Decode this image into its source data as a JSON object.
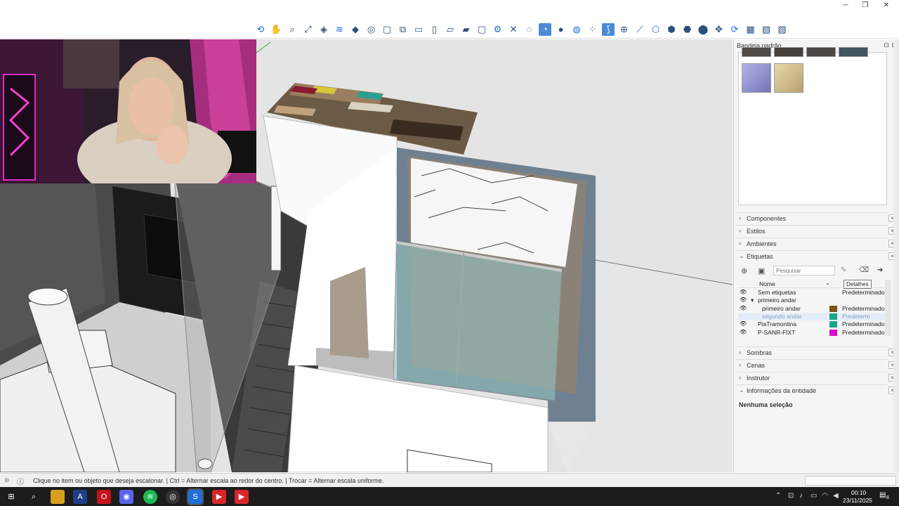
{
  "window": {
    "minimize": "─",
    "restore": "❐",
    "close": "✕"
  },
  "toolbar": {
    "icons": [
      "orbit-icon",
      "pan-icon",
      "zoom-icon",
      "zoom-extents-icon",
      "section-plane-icon",
      "section-cuts-icon",
      "section-fill-icon",
      "view-icon",
      "iso-icon",
      "top-icon",
      "front-icon",
      "right-icon",
      "back-icon",
      "left-icon",
      "xray-icon",
      "back-edges-icon",
      "wireframe-icon",
      "hidden-line-icon",
      "shaded-icon",
      "shaded-textures-icon",
      "monochrome-icon",
      "snap-icon",
      "magnet-icon",
      "axes-icon",
      "guide-icon",
      "cube-icon",
      "cube-outline-icon",
      "cube-solid-icon",
      "cube-x-icon",
      "move-icon",
      "rotate-icon",
      "grid-icon",
      "grid2-icon",
      "grid3-icon"
    ]
  },
  "tray": {
    "title": "Bandeja padrão",
    "panels_top": [
      {
        "label": "Componentes",
        "chev": "›"
      },
      {
        "label": "Estilos",
        "chev": "›"
      },
      {
        "label": "Ambientes",
        "chev": "›"
      },
      {
        "label": "Etiquetas",
        "chev": "⌄"
      }
    ],
    "tags": {
      "search_placeholder": "Pesquisar",
      "tooltip": "Detalhes",
      "col_name": "Nome",
      "rows": [
        {
          "name": "Sem etiquetas",
          "dash": "Predeterminado",
          "color": "",
          "indent": 0,
          "visible": true,
          "dim": false,
          "arrow": ""
        },
        {
          "name": "primeiro andar",
          "dash": "",
          "color": "",
          "indent": 0,
          "visible": true,
          "dim": false,
          "arrow": "▾"
        },
        {
          "name": "primeiro andar",
          "dash": "Predeterminado",
          "color": "#7a5518",
          "indent": 1,
          "visible": true,
          "dim": false,
          "arrow": ""
        },
        {
          "name": "segundo andar",
          "dash": "Predeterm",
          "color": "#1aa58a",
          "indent": 1,
          "visible": false,
          "dim": true,
          "arrow": ""
        },
        {
          "name": "PiaTramontina",
          "dash": "Predeterminado",
          "color": "#1aa58a",
          "indent": 0,
          "visible": true,
          "dim": false,
          "arrow": ""
        },
        {
          "name": "P-SANR-FIXT",
          "dash": "Predeterminado",
          "color": "#d60fc8",
          "indent": 0,
          "visible": true,
          "dim": false,
          "arrow": ""
        }
      ]
    },
    "panels_bottom": [
      {
        "label": "Sombras",
        "chev": "›"
      },
      {
        "label": "Cenas",
        "chev": "›"
      },
      {
        "label": "Instrutor",
        "chev": "›"
      },
      {
        "label": "Informações da entidade",
        "chev": "⌄"
      }
    ],
    "entity_info": "Nenhuma seleção"
  },
  "status": {
    "message": "Clique no item ou objeto que deseja escalonar. | Ctrl = Alternar escala ao redor do centro. | Trocar = Alternar escala uniforme."
  },
  "taskbar": {
    "time": "00:10",
    "date": "23/11/2025",
    "notification_count": "8"
  },
  "colors": {
    "tag_brown": "#7a5518",
    "tag_teal": "#1aa58a",
    "tag_magenta": "#d60fc8",
    "accent_blue": "#1e6fd9"
  }
}
